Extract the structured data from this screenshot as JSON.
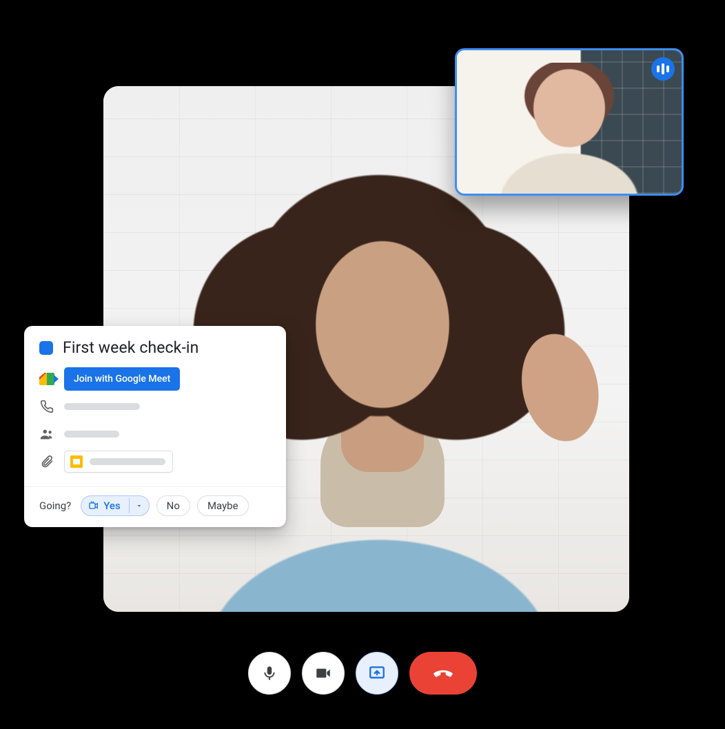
{
  "event": {
    "title": "First week check-in",
    "join_button": "Join with Google Meet",
    "going_label": "Going?",
    "rsvp": {
      "yes": "Yes",
      "no": "No",
      "maybe": "Maybe"
    }
  },
  "colors": {
    "accent": "#1a73e8",
    "danger": "#ea4335"
  },
  "icons": {
    "mic": "mic-icon",
    "video": "video-icon",
    "present": "present-icon",
    "hangup": "hangup-icon",
    "speaking": "speaking-indicator-icon",
    "phone": "phone-icon",
    "people": "people-icon",
    "attachment": "attachment-icon",
    "slides": "slides-icon",
    "virtual_location": "virtual-location-icon",
    "caret_down": "caret-down-icon"
  }
}
